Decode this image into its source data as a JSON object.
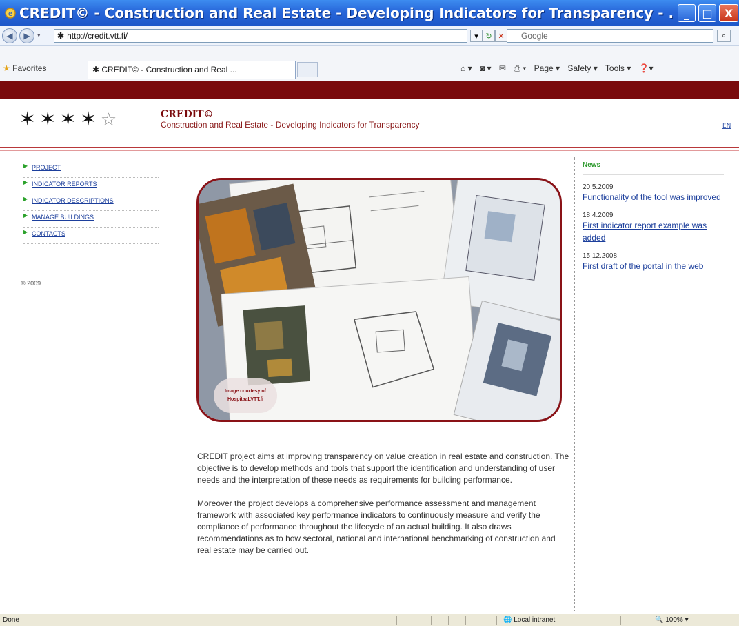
{
  "window": {
    "title": "CREDIT© - Construction and Real Estate - Developing Indicators for Transparency - ...",
    "minimize": "_",
    "maximize": "□",
    "close": "X"
  },
  "address_bar": {
    "url": "http://credit.vtt.fi/",
    "search_placeholder": "Google"
  },
  "favorites_bar": {
    "favorites_label": "Favorites",
    "tab_title": "CREDIT© - Construction and Real ...",
    "commands": [
      "Page ▾",
      "Safety ▾",
      "Tools ▾"
    ]
  },
  "header": {
    "brand_name": "CREDIT©",
    "tagline": "Construction and Real Estate - Developing Indicators for Transparency",
    "language": "EN"
  },
  "nav": {
    "items": [
      {
        "label": "Project"
      },
      {
        "label": "Indicator reports"
      },
      {
        "label": "Indicator descriptions"
      },
      {
        "label": "Manage buildings"
      },
      {
        "label": "Contacts"
      }
    ],
    "copyright": "© 2009"
  },
  "hero": {
    "credit_text": "Image courtesy of HospitaaLVTT.fi"
  },
  "content": {
    "paragraphs": [
      "CREDIT project aims at improving transparency on value creation in real estate and construction. The objective is to develop methods and tools that support the identification and understanding of user needs and the interpretation of these needs as requirements for building performance.",
      "Moreover the project develops a comprehensive performance assessment and management framework with associated key performance indicators to continuously measure and verify the compliance of performance throughout the lifecycle of an actual building. It also draws recommendations as to how sectoral, national and international benchmarking of construction and real estate may be carried out."
    ]
  },
  "news": {
    "heading": "News",
    "items": [
      {
        "date": "20.5.2009",
        "title": "Functionality of the tool was improved"
      },
      {
        "date": "18.4.2009",
        "title": "First indicator report example was added"
      },
      {
        "date": "15.12.2008",
        "title": "First draft of the portal in the web"
      }
    ]
  },
  "status_bar": {
    "status": "Done",
    "zone": "Local intranet",
    "zoom": "100%"
  },
  "colors": {
    "brand_red": "#7a0a0c",
    "link_blue": "#1c3f9c",
    "news_green": "#2e9a2e"
  }
}
